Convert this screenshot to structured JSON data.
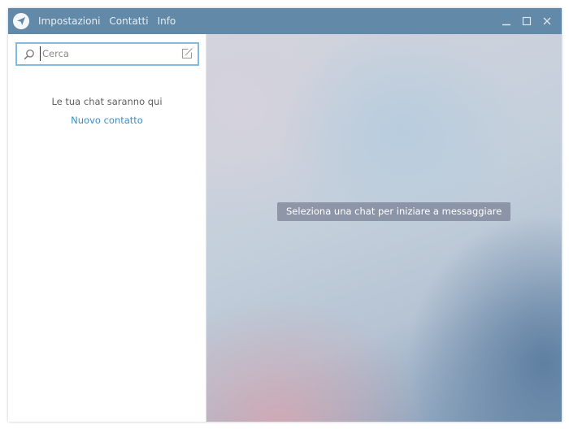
{
  "window": {
    "menu": [
      "Impostazioni",
      "Contatti",
      "Info"
    ],
    "controls": [
      "minimize-icon",
      "maximize-icon",
      "close-icon"
    ],
    "colors": {
      "titlebar": "#6389a8",
      "accent": "#3a8fc6",
      "search_border": "#83bbe0"
    }
  },
  "sidebar": {
    "search": {
      "placeholder": "Cerca",
      "value": ""
    },
    "empty_text": "Le tua chat saranno qui",
    "new_contact": "Nuovo contatto"
  },
  "chat": {
    "placeholder": "Seleziona una chat per iniziare a messaggiare"
  }
}
